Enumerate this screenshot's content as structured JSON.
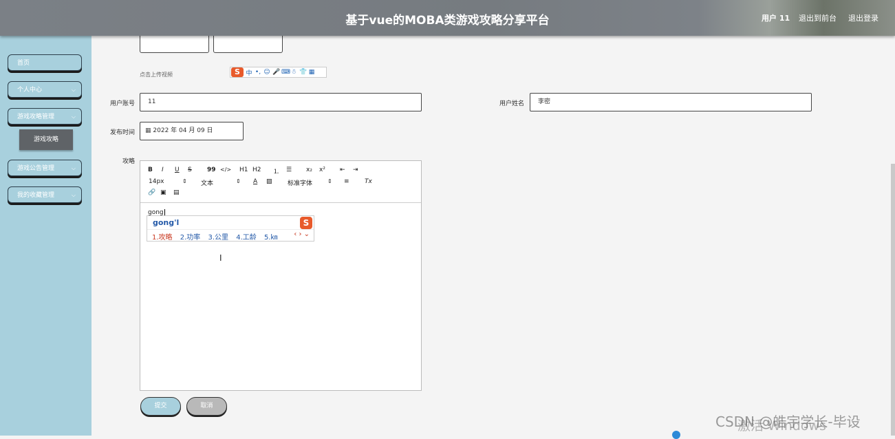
{
  "header": {
    "title": "基于vue的MOBA类游戏攻略分享平台",
    "user": "用户 11",
    "back_to_front": "退出到前台",
    "logout": "退出登录"
  },
  "sidebar": {
    "items": [
      {
        "label": "首页"
      },
      {
        "label": "个人中心"
      },
      {
        "label": "游戏攻略管理"
      },
      {
        "label": "游戏公告管理"
      },
      {
        "label": "我的收藏管理"
      }
    ],
    "sub_item": "游戏攻略",
    "chevron": "⌵"
  },
  "form": {
    "upload_tip": "点击上传视频",
    "account_label": "用户账号",
    "account_value": "11",
    "name_label": "用户姓名",
    "name_value": "李密",
    "date_label": "发布时间",
    "date_value": "2022 年 04 月 09 日",
    "guide_label": "攻略",
    "submit_label": "提交",
    "cancel_label": "取消"
  },
  "ime_toolbar": {
    "logo": "S",
    "items": [
      "中",
      "•,",
      "☺",
      "🎤",
      "⌨",
      "☃",
      "👕",
      "▦"
    ]
  },
  "editor": {
    "toolbar": {
      "bold": "B",
      "italic": "I",
      "underline": "U",
      "strike": "S",
      "quote": "99",
      "code": "</>",
      "h1": "H1",
      "h2": "H2",
      "ol": "⒈",
      "ul": "☰",
      "sub": "x₂",
      "sup": "x²",
      "outdent": "⇤",
      "indent": "⇥",
      "size": "14px",
      "size_arrow": "⇕",
      "header": "文本",
      "header_arrow": "⇕",
      "color": "A",
      "background": "▨",
      "font": "标准字体",
      "font_arrow": "⇕",
      "align": "≡",
      "clean": "Tx",
      "link": "🔗",
      "image": "▣",
      "video": "▤"
    },
    "content": "gong"
  },
  "ime_popup": {
    "pinyin": "gong'l",
    "logo": "S",
    "candidates": [
      "1.攻略",
      "2.功率",
      "3.公里",
      "4.工龄",
      "5.㎞"
    ],
    "nav": "‹ › ⌄"
  },
  "watermarks": {
    "activate": "激活 Windows",
    "csdn": "CSDN @皓宇学长-毕设"
  }
}
